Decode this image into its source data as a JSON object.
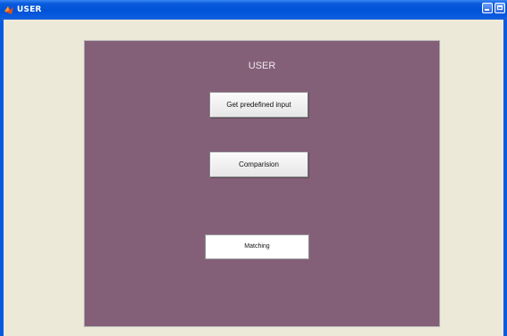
{
  "window": {
    "title": "USER",
    "icon": "matlab-icon",
    "controls": [
      "minimize-icon",
      "maximize-icon"
    ]
  },
  "panel": {
    "title": "USER",
    "background_color": "#836078"
  },
  "buttons": {
    "predefined_input": "Get  predefined input",
    "comparision": "Comparision",
    "matching": "Matching"
  }
}
